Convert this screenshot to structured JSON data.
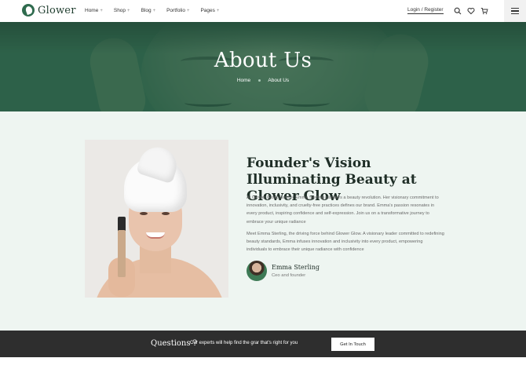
{
  "brand": {
    "name": "Glower"
  },
  "nav": {
    "items": [
      {
        "label": "Home",
        "marker": "+"
      },
      {
        "label": "Shop",
        "marker": "+"
      },
      {
        "label": "Blog",
        "marker": "+"
      },
      {
        "label": "Portfolio",
        "marker": "+"
      },
      {
        "label": "Pages",
        "marker": "+"
      }
    ]
  },
  "header": {
    "login_label": "Login / Register",
    "icons": [
      "search-icon",
      "heart-icon",
      "cart-icon",
      "hamburger-menu-icon"
    ]
  },
  "hero": {
    "title": "About Us",
    "breadcrumb": {
      "home": "Home",
      "current": "About Us"
    }
  },
  "about": {
    "heading": "Founder's Vision Illuminating Beauty at Glower Glow",
    "paragraph1": "At Glower Glow, founder Emma Sterling pioneers a beauty revolution. Her visionary commitment to innovation, inclusivity, and cruelty-free practices defines our brand. Emma's passion resonates in every product, inspiring confidence and self-expression. Join us on a transformative journey to embrace your unique radiance",
    "paragraph2": "Meet Emma Sterling, the driving force behind Glower Glow. A visionary leader committed to redefining beauty standards, Emma infuses innovation and inclusivity into every product, empowering individuals to embrace their unique radiance with confidence",
    "founder": {
      "name": "Emma Sterling",
      "role": "Ceo and founder"
    }
  },
  "cta": {
    "question": "Questions ?",
    "text": "Our experts will help find the grar that's right for you",
    "button": "Get In Touch"
  },
  "colors": {
    "brand_green": "#2f6b4e",
    "hero_overlay": "#20563e",
    "section_bg": "#eef5f1",
    "cta_bg": "#2e2e2e"
  }
}
